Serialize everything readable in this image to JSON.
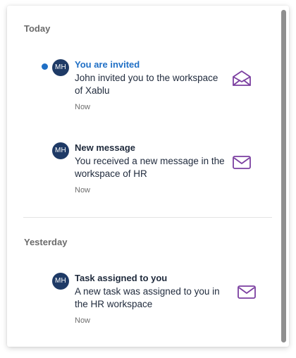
{
  "sections": [
    {
      "title": "Today",
      "notifications": [
        {
          "avatar": "MH",
          "title": "You are invited",
          "body": "John invited you to the workspace of Xablu",
          "time": "Now",
          "unread": true,
          "icon": "envelope-open-icon"
        },
        {
          "avatar": "MH",
          "title": "New message",
          "body": "You received a new message in the workspace of HR",
          "time": "Now",
          "unread": false,
          "icon": "envelope-icon"
        }
      ]
    },
    {
      "title": "Yesterday",
      "notifications": [
        {
          "avatar": "MH",
          "title": "Task assigned to you",
          "body": "A new task was assigned to you in the HR workspace",
          "time": "Now",
          "unread": false,
          "icon": "envelope-icon"
        }
      ]
    }
  ],
  "colors": {
    "accent": "#1f6fc5",
    "avatar_bg": "#1e3a66",
    "icon": "#7b3fa0",
    "text": "#1f2a3c",
    "muted": "#6e6e6e"
  }
}
